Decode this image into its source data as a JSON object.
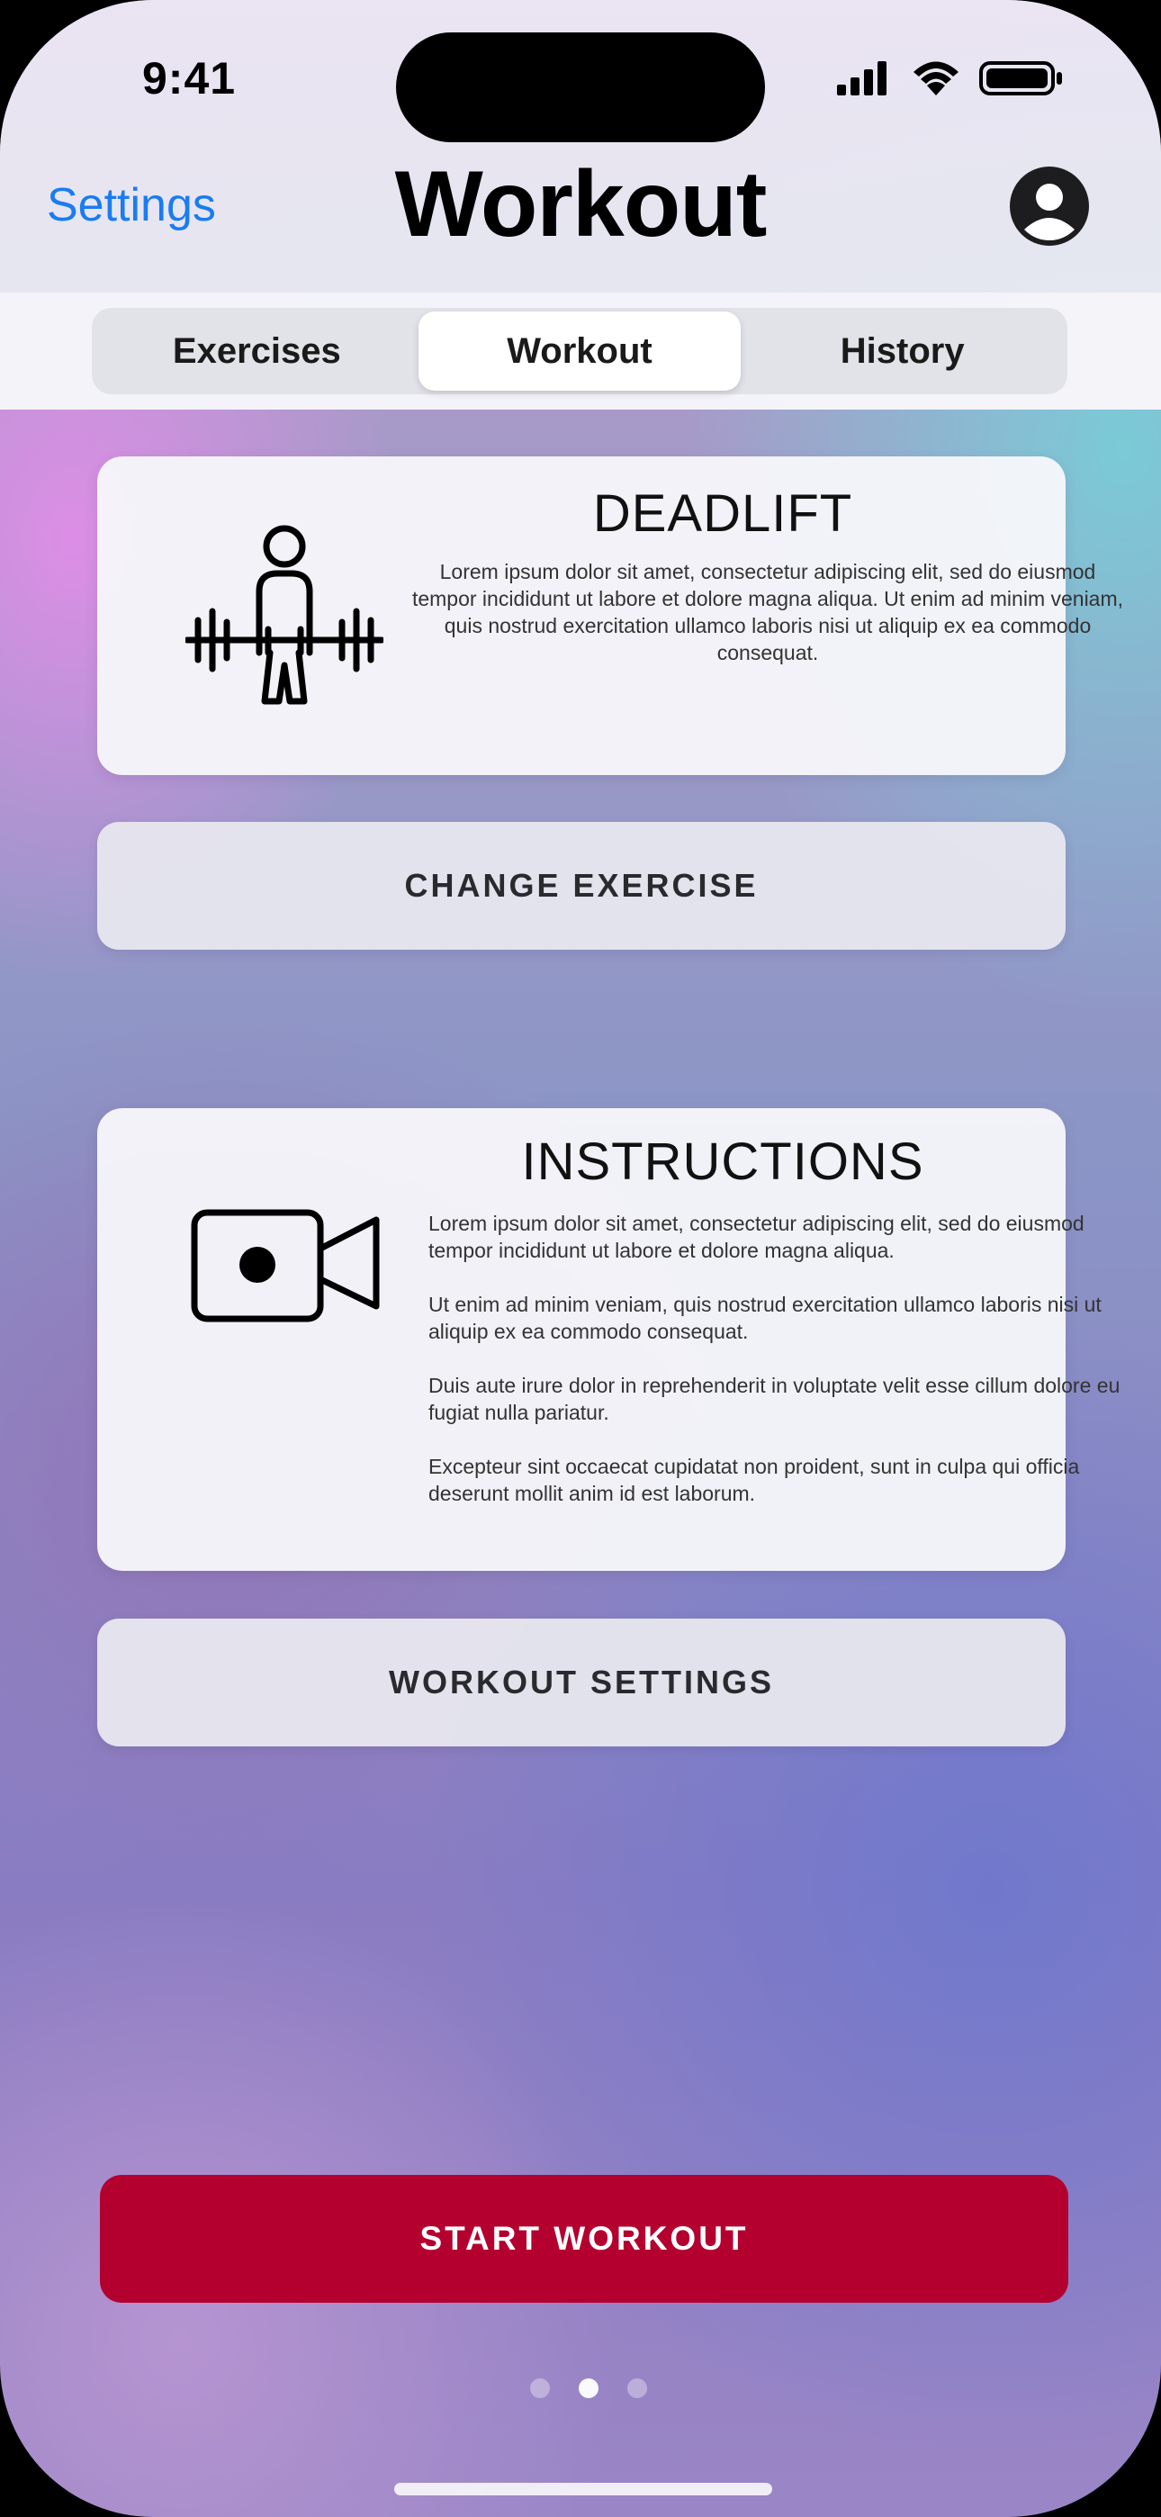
{
  "status_bar": {
    "time": "9:41"
  },
  "nav": {
    "back_label": "Settings",
    "title": "Workout",
    "avatar_icon": "person-circle-icon"
  },
  "segmented": {
    "items": [
      "Exercises",
      "Workout",
      "History"
    ],
    "selected": "Workout"
  },
  "exercise_card": {
    "icon": "deadlift-icon",
    "title": "DEADLIFT",
    "description": "Lorem ipsum dolor sit amet, consectetur adipiscing elit, sed do eiusmod tempor incididunt ut labore et dolore magna aliqua. Ut enim ad minim veniam, quis nostrud exercitation ullamco laboris nisi ut aliquip ex ea commodo consequat."
  },
  "change_exercise_button": "CHANGE EXERCISE",
  "instructions_card": {
    "icon": "video-camera-icon",
    "title": "INSTRUCTIONS",
    "paragraphs": [
      "Lorem ipsum dolor sit amet, consectetur adipiscing elit, sed do eiusmod tempor incididunt ut labore et dolore magna aliqua.",
      "Ut enim ad minim veniam, quis nostrud exercitation ullamco laboris nisi ut aliquip ex ea commodo consequat.",
      " Duis aute irure dolor in reprehenderit in voluptate velit esse cillum dolore eu fugiat nulla pariatur.",
      "Excepteur sint occaecat cupidatat non proident, sunt in culpa qui officia deserunt mollit anim id est laborum."
    ]
  },
  "workout_settings_button": "WORKOUT SETTINGS",
  "start_workout_button": "START WORKOUT",
  "pager": {
    "pages": 3,
    "current": 2
  },
  "colors": {
    "accent_blue": "#1a7cf0",
    "primary_red": "#b3002f"
  }
}
